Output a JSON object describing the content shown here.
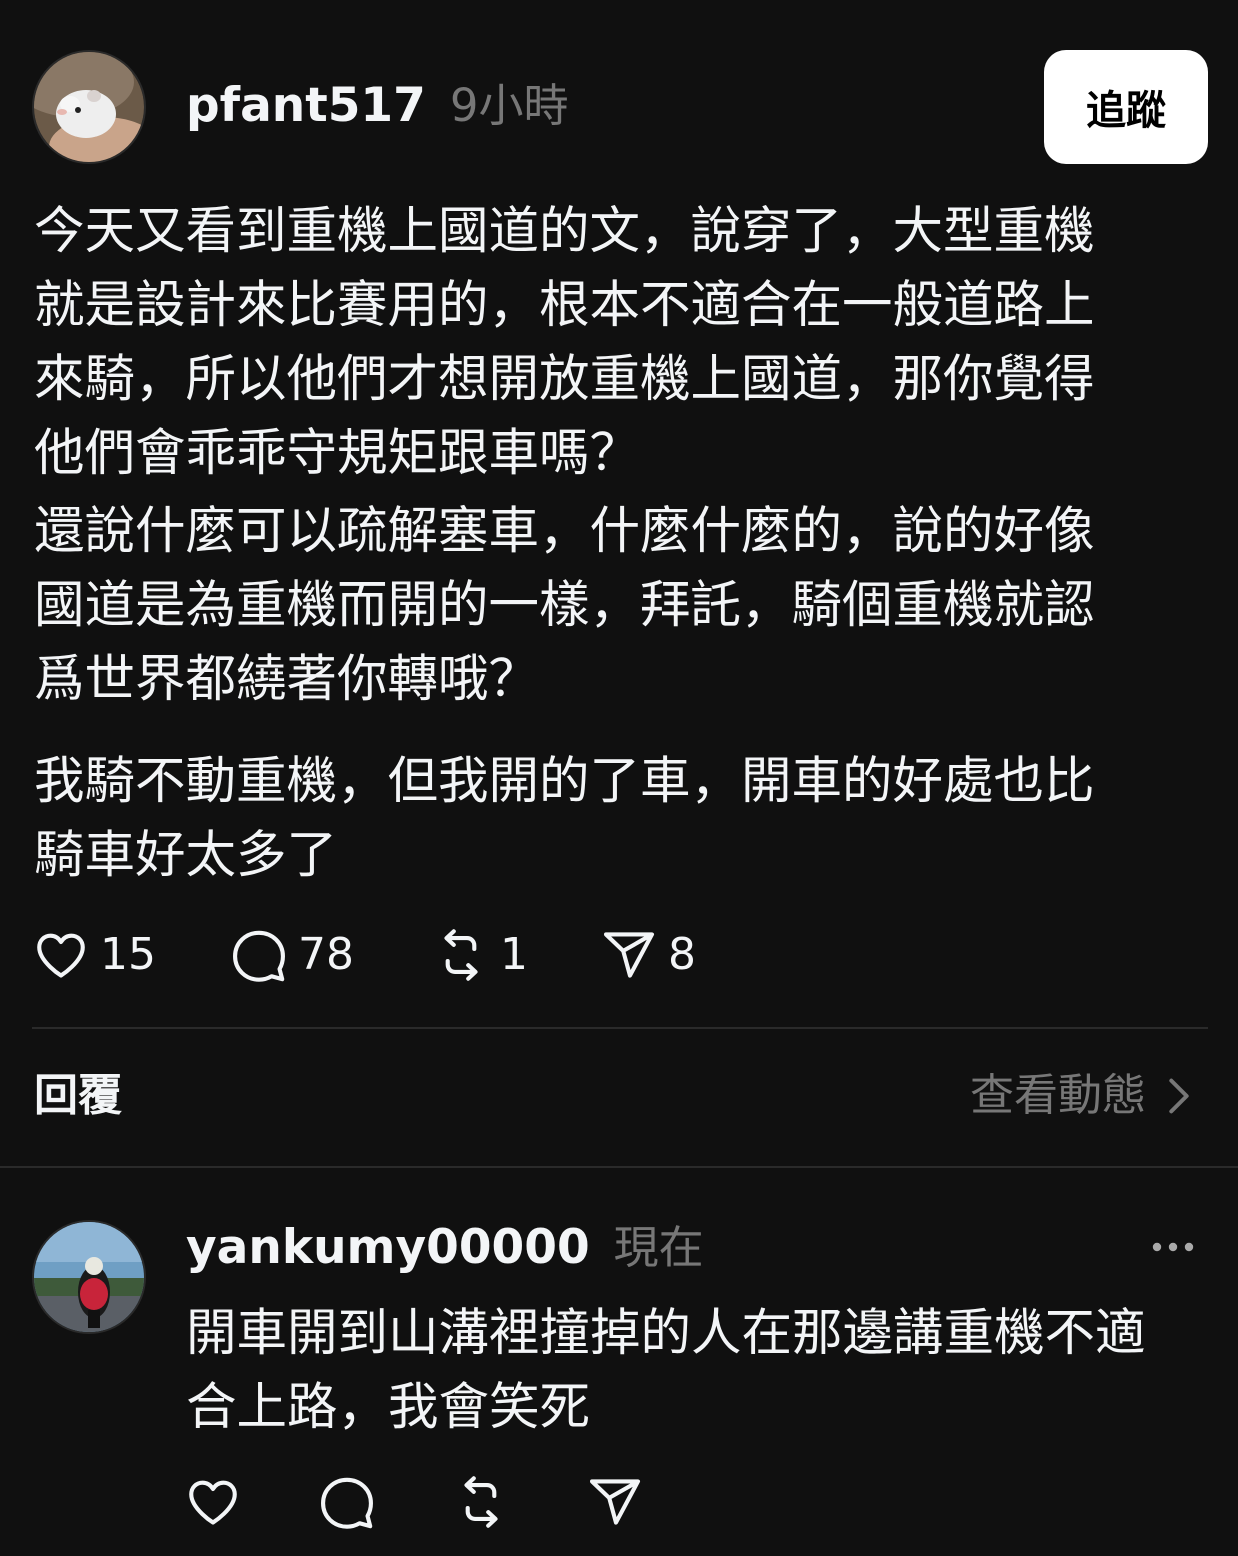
{
  "post": {
    "username": "pfant517",
    "time": "9小時",
    "follow_label": "追蹤",
    "paragraphs": [
      [
        "今天又看到重機上國道的文，說穿了，大型重機",
        "就是設計來比賽用的，根本不適合在一般道路上",
        "來騎，所以他們才想開放重機上國道，那你覺得",
        "他們會乖乖守規矩跟車嗎？"
      ],
      [
        "還說什麼可以疏解塞車，什麼什麼的，說的好像",
        "國道是為重機而開的一樣，拜託，騎個重機就認",
        "爲世界都繞著你轉哦？"
      ],
      [
        "我騎不動重機，但我開的了車，開車的好處也比",
        "騎車好太多了"
      ]
    ],
    "counts": {
      "likes": "15",
      "comments": "78",
      "reposts": "1",
      "shares": "8"
    }
  },
  "replies_header": {
    "label": "回覆",
    "view_activity": "查看動態"
  },
  "reply": {
    "username": "yankumy00000",
    "time": "現在",
    "lines": [
      "開車開到山溝裡撞掉的人在那邊講重機不適",
      "合上路，我會笑死"
    ]
  },
  "icons": {
    "like": "heart-icon",
    "comment": "comment-bubble-icon",
    "repost": "repost-icon",
    "share": "send-icon",
    "more": "more-dots-icon",
    "chevron": "chevron-right-icon"
  },
  "colors": {
    "background": "#101010",
    "text": "#f3f5f7",
    "muted": "#777777",
    "divider": "#2a2a2a",
    "follow_bg": "#ffffff"
  }
}
